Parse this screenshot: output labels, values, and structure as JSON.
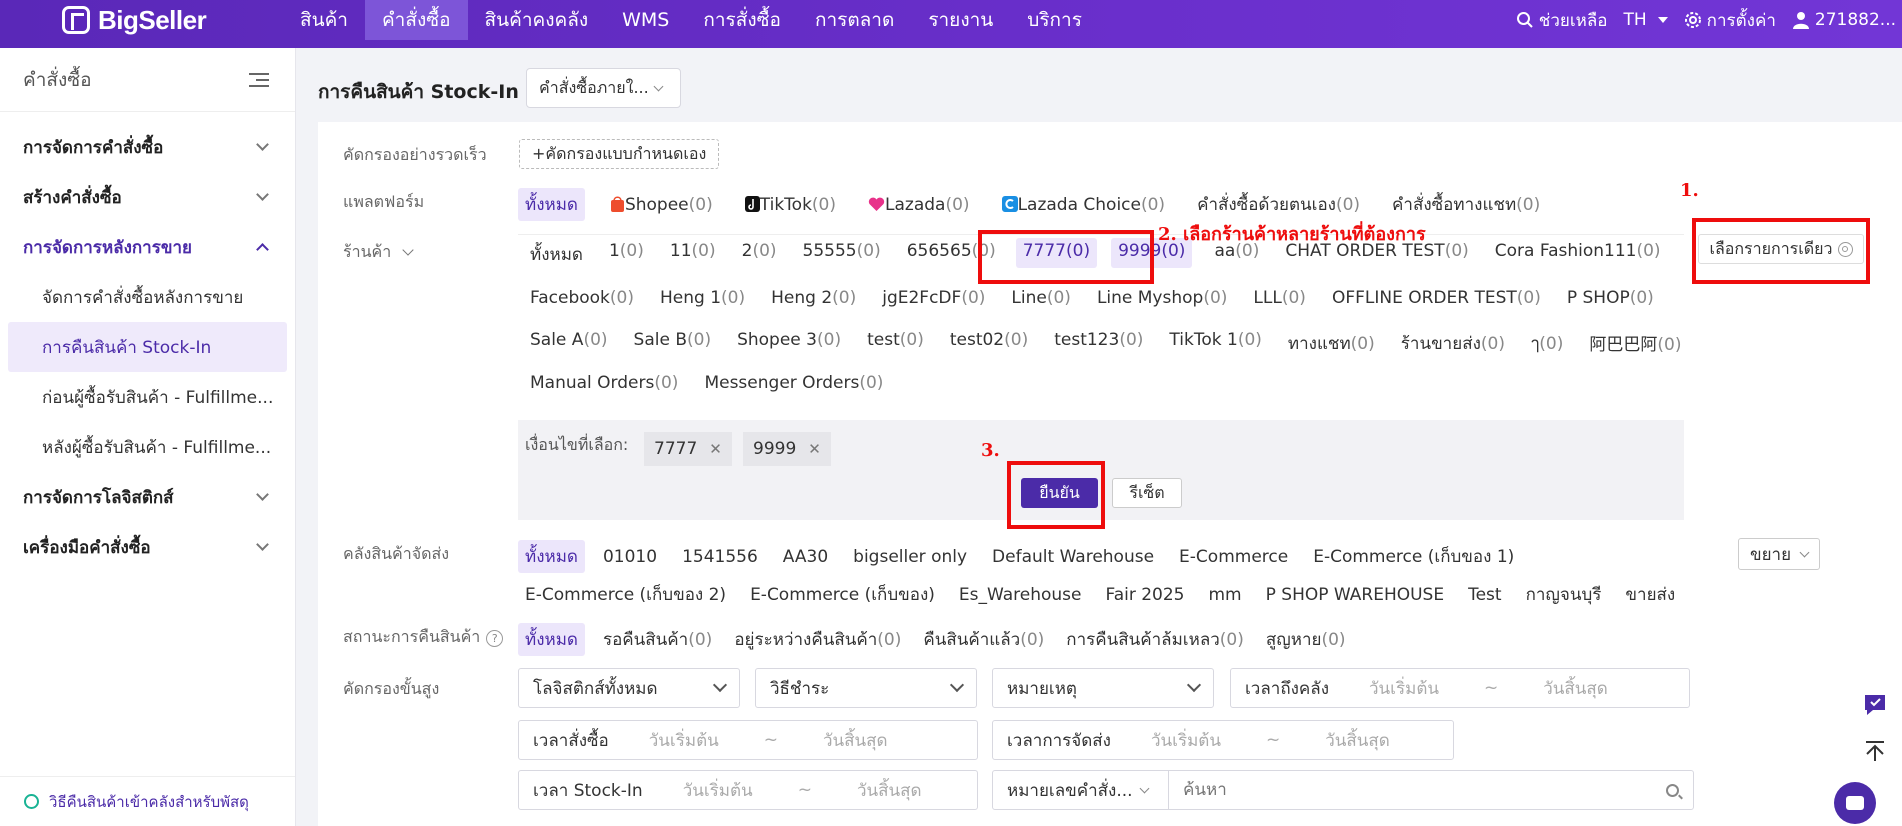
{
  "brand": {
    "name": "BigSeller"
  },
  "nav": {
    "items": [
      "สินค้า",
      "คำสั่งซื้อ",
      "สินค้าคงคลัง",
      "WMS",
      "การสั่งซื้อ",
      "การตลาด",
      "รายงาน",
      "บริการ"
    ],
    "active_index": 1,
    "help": "ช่วยเหลือ",
    "lang": "TH",
    "settings": "การตั้งค่า",
    "user": "271882..."
  },
  "sidebar": {
    "title": "คำสั่งซื้อ",
    "groups": [
      "การจัดการคำสั่งซื้อ",
      "สร้างคำสั่งซื้อ",
      "การจัดการหลังการขาย",
      "การจัดการโลจิสติกส์",
      "เครื่องมือคำสั่งซื้อ"
    ],
    "subs": [
      "จัดการคำสั่งซื้อหลังการขาย",
      "การคืนสินค้า Stock-In",
      "ก่อนผู้ซื้อรับสินค้า - Fulfillme...",
      "หลังผู้ซื้อรับสินค้า - Fulfillme..."
    ],
    "footer": "วิธีคืนสินค้าเข้าคลังสำหรับพัสดุ"
  },
  "page": {
    "title": "การคืนสินค้า Stock-In",
    "order_type": "คำสั่งซื้อภายใ..."
  },
  "filters": {
    "quick_label": "คัดกรองอย่างรวดเร็ว",
    "custom_btn": "+คัดกรองแบบกำหนดเอง",
    "platform_label": "แพลตฟอร์ม",
    "platforms": [
      {
        "name": "ทั้งหมด",
        "count": ""
      },
      {
        "name": "Shopee",
        "count": "(0)"
      },
      {
        "name": "TikTok",
        "count": "(0)"
      },
      {
        "name": "Lazada",
        "count": "(0)"
      },
      {
        "name": "Lazada Choice",
        "count": "(0)"
      },
      {
        "name": "คำสั่งซื้อด้วยตนเอง",
        "count": "(0)"
      },
      {
        "name": "คำสั่งซื้อทางแชท",
        "count": "(0)"
      }
    ],
    "store_label": "ร้านค้า",
    "stores_row1": [
      {
        "name": "ทั้งหมด",
        "count": ""
      },
      {
        "name": "1",
        "count": "(0)"
      },
      {
        "name": "11",
        "count": "(0)"
      },
      {
        "name": "2",
        "count": "(0)"
      },
      {
        "name": "55555",
        "count": "(0)"
      },
      {
        "name": "656565",
        "count": "(0)"
      },
      {
        "name": "7777",
        "count": "(0)"
      },
      {
        "name": "9999",
        "count": "(0)"
      },
      {
        "name": "aa",
        "count": "(0)"
      },
      {
        "name": "CHAT ORDER TEST",
        "count": "(0)"
      },
      {
        "name": "Cora Fashion111",
        "count": "(0)"
      }
    ],
    "stores_row2": [
      {
        "name": "Facebook",
        "count": "(0)"
      },
      {
        "name": "Heng 1",
        "count": "(0)"
      },
      {
        "name": "Heng 2",
        "count": "(0)"
      },
      {
        "name": "jgE2FcDF",
        "count": "(0)"
      },
      {
        "name": "Line",
        "count": "(0)"
      },
      {
        "name": "Line Myshop",
        "count": "(0)"
      },
      {
        "name": "LLL",
        "count": "(0)"
      },
      {
        "name": "OFFLINE ORDER TEST",
        "count": "(0)"
      },
      {
        "name": "P SHOP",
        "count": "(0)"
      }
    ],
    "stores_row3": [
      {
        "name": "Sale A",
        "count": "(0)"
      },
      {
        "name": "Sale B",
        "count": "(0)"
      },
      {
        "name": "Shopee 3",
        "count": "(0)"
      },
      {
        "name": "test",
        "count": "(0)"
      },
      {
        "name": "test02",
        "count": "(0)"
      },
      {
        "name": "test123",
        "count": "(0)"
      },
      {
        "name": "TikTok 1",
        "count": "(0)"
      },
      {
        "name": "ทางแชท",
        "count": "(0)"
      },
      {
        "name": "ร้านขายส่ง",
        "count": "(0)"
      },
      {
        "name": "ๅ",
        "count": "(0)"
      },
      {
        "name": "阿巴巴阿",
        "count": "(0)"
      }
    ],
    "stores_row4": [
      {
        "name": "Manual Orders",
        "count": "(0)"
      },
      {
        "name": "Messenger Orders",
        "count": "(0)"
      }
    ],
    "single_select": "เลือกรายการเดียว",
    "selected_label": "เงื่อนไขที่เลือก:",
    "selected_tags": [
      "7777",
      "9999"
    ],
    "confirm": "ยืนยัน",
    "reset": "รีเซ็ต",
    "warehouse_label": "คลังสินค้าจัดส่ง",
    "warehouses_row1": [
      "ทั้งหมด",
      "01010",
      "1541556",
      "AA30",
      "bigseller only",
      "Default Warehouse",
      "E-Commerce",
      "E-Commerce (เก็บของ 1)"
    ],
    "warehouses_row2": [
      "E-Commerce (เก็บของ 2)",
      "E-Commerce (เก็บของ)",
      "Es_Warehouse",
      "Fair 2025",
      "mm",
      "P SHOP WAREHOUSE",
      "Test",
      "กาญจนบุรี",
      "ขายส่ง"
    ],
    "expand": "ขยาย",
    "status_label": "สถานะการคืนสินค้า",
    "statuses": [
      {
        "name": "ทั้งหมด",
        "count": ""
      },
      {
        "name": "รอคืนสินค้า",
        "count": "(0)"
      },
      {
        "name": "อยู่ระหว่างคืนสินค้า",
        "count": "(0)"
      },
      {
        "name": "คืนสินค้าแล้ว",
        "count": "(0)"
      },
      {
        "name": "การคืนสินค้าล้มเหลว",
        "count": "(0)"
      },
      {
        "name": "สูญหาย",
        "count": "(0)"
      }
    ],
    "advanced_label": "คัดกรองขั้นสูง",
    "logistics": "โลจิสติกส์ทั้งหมด",
    "payment": "วิธีชำระ",
    "note": "หมายเหตุ",
    "arrive_time": "เวลาถึงคลัง",
    "order_time": "เวลาสั่งซื้อ",
    "ship_time": "เวลาการจัดส่ง",
    "stockin_time": "เวลา Stock-In",
    "start": "วันเริ่มต้น",
    "end": "วันสิ้นสุด",
    "tilde": "~",
    "search_type": "หมายเลขคำสั่ง...",
    "search_ph": "ค้นหา"
  },
  "annotations": {
    "a1": "1.",
    "a2": "2. เลือกร้านค้าหลายร้านที่ต้องการ",
    "a3": "3."
  },
  "colors": {
    "brand": "#5a28b8",
    "accent": "#4b2ba8",
    "annotation": "#ee0d0d"
  }
}
